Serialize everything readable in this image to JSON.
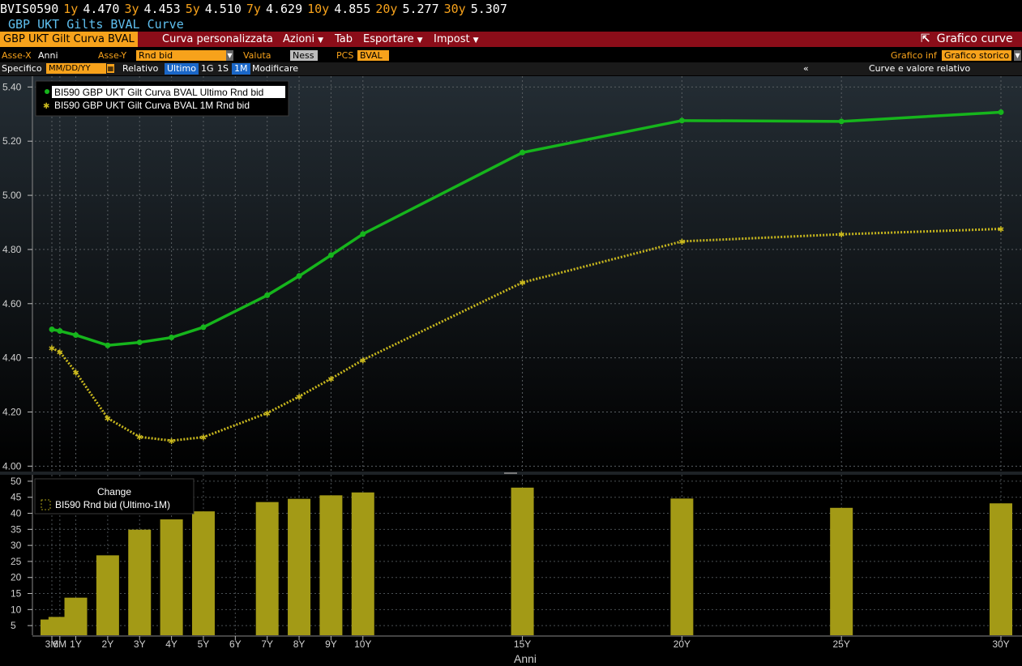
{
  "ticker": {
    "security": "BVIS0590",
    "items": [
      {
        "label": "1y",
        "value": "4.470"
      },
      {
        "label": "3y",
        "value": "4.453"
      },
      {
        "label": "5y",
        "value": "4.510"
      },
      {
        "label": "7y",
        "value": "4.629"
      },
      {
        "label": "10y",
        "value": "4.855"
      },
      {
        "label": "20y",
        "value": "5.277"
      },
      {
        "label": "30y",
        "value": "5.307"
      }
    ]
  },
  "title": "GBP UKT Gilts BVAL Curve",
  "menubar": {
    "curve_name": "GBP UKT Gilt Curva BVAL",
    "custom_curve": "Curva personalizzata",
    "actions": "Azioni",
    "tab": "Tab",
    "export": "Esportare",
    "settings": "Impost",
    "chart_button": "Grafico curve"
  },
  "options": {
    "x_axis_label": "Asse-X",
    "x_axis_value": "Anni",
    "y_axis_label": "Asse-Y",
    "y_axis_value": "Rnd bid",
    "currency_label": "Valuta",
    "currency_value": "Ness",
    "pcs_label": "PCS",
    "pcs_value": "BVAL",
    "chart_info_label": "Grafico inf",
    "chart_info_value": "Grafico storico",
    "specific_label": "Specifico",
    "date_placeholder": "MM/DD/YY",
    "relative_label": "Relativo",
    "relative_options": [
      "Ultimo",
      "1G",
      "1S",
      "1M"
    ],
    "relative_selected": [
      "Ultimo",
      "1M"
    ],
    "modify": "Modificare",
    "collapse": "«",
    "curve_relative": "Curve e valore relativo"
  },
  "colors": {
    "background_top": "#242d34",
    "background_bottom": "#000000",
    "last_series": "#16b51c",
    "month_series": "#c9b81e",
    "bar_fill": "#a39a16",
    "accent": "#f7a21b",
    "menubar": "#8b0d19"
  },
  "chart_data": [
    {
      "type": "line",
      "categories": [
        "3M",
        "6M",
        "1Y",
        "2Y",
        "3Y",
        "4Y",
        "5Y",
        "6Y",
        "7Y",
        "8Y",
        "9Y",
        "10Y",
        "15Y",
        "20Y",
        "25Y",
        "30Y"
      ],
      "x_years": [
        0.25,
        0.5,
        1,
        2,
        3,
        4,
        5,
        6,
        7,
        8,
        9,
        10,
        15,
        20,
        25,
        30
      ],
      "series": [
        {
          "name": "BI590 GBP UKT Gilt Curva BVAL Ultimo Rnd bid",
          "marker": "dot",
          "x": [
            0.25,
            0.5,
            1,
            2,
            3,
            4,
            5,
            7,
            8,
            9,
            10,
            15,
            20,
            25,
            30
          ],
          "values": [
            4.505,
            4.499,
            4.484,
            4.446,
            4.457,
            4.475,
            4.513,
            4.631,
            4.702,
            4.779,
            4.857,
            5.158,
            5.276,
            5.273,
            5.307
          ]
        },
        {
          "name": "BI590 GBP UKT Gilt Curva BVAL 1M Rnd bid",
          "marker": "star",
          "x": [
            0.25,
            0.5,
            1,
            2,
            3,
            4,
            5,
            7,
            8,
            9,
            10,
            15,
            20,
            25,
            30
          ],
          "values": [
            4.436,
            4.422,
            4.347,
            4.177,
            4.108,
            4.094,
            4.107,
            4.196,
            4.257,
            4.323,
            4.392,
            4.678,
            4.83,
            4.856,
            4.876
          ]
        }
      ],
      "ylim": [
        3.98,
        5.44
      ],
      "yticks": [
        4.0,
        4.2,
        4.4,
        4.6,
        4.8,
        5.0,
        5.2,
        5.4
      ],
      "grid": true,
      "legend": "top-left"
    },
    {
      "type": "bar",
      "title": "Change",
      "series": [
        {
          "name": "BI590 Rnd bid (Ultimo-1M)",
          "x": [
            0.25,
            0.5,
            1,
            2,
            3,
            4,
            5,
            7,
            8,
            9,
            10,
            15,
            20,
            25,
            30
          ],
          "values": [
            6.9,
            7.7,
            13.7,
            26.9,
            34.9,
            38.1,
            40.6,
            43.5,
            44.5,
            45.6,
            46.5,
            48.0,
            44.6,
            41.7,
            43.1
          ]
        }
      ],
      "ylim": [
        2,
        52
      ],
      "yticks": [
        5,
        10,
        15,
        20,
        25,
        30,
        35,
        40,
        45,
        50
      ],
      "xlabel": "Anni",
      "grid": true,
      "legend": "top-left"
    }
  ]
}
